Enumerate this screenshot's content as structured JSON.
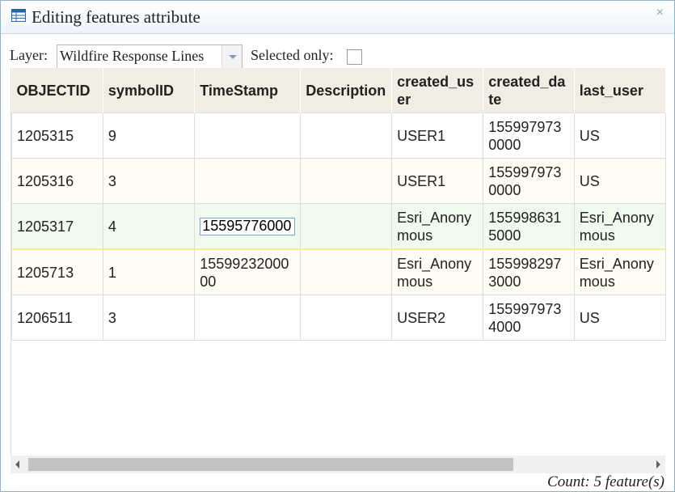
{
  "dialog": {
    "title": "Editing features attribute",
    "close_glyph": "×"
  },
  "toolbar": {
    "layer_label": "Layer:",
    "layer_value": "Wildfire Response Lines",
    "selected_only_label": "Selected only:"
  },
  "table": {
    "columns": [
      "OBJECTID",
      "symbolID",
      "TimeStamp",
      "Description",
      "created_user",
      "created_date",
      "last_user"
    ],
    "rows": [
      [
        "1205315",
        "9",
        "",
        "",
        "USER1",
        "1559979730000",
        "US"
      ],
      [
        "1205316",
        "3",
        "",
        "",
        "USER1",
        "1559979730000",
        "US"
      ],
      [
        "1205317",
        "4",
        "15595776000",
        "",
        "Esri_Anonymous",
        "1559986315000",
        "Esri_Anonymous"
      ],
      [
        "1205713",
        "1",
        "1559923200000",
        "",
        "Esri_Anonymous",
        "1559982973000",
        "Esri_Anonymous"
      ],
      [
        "1206511",
        "3",
        "",
        "",
        "USER2",
        "1559979734000",
        "US"
      ]
    ],
    "editing": {
      "row": 2,
      "column": 2,
      "value": "15595776000"
    }
  },
  "footer": {
    "count": "Count: 5 feature(s)"
  }
}
